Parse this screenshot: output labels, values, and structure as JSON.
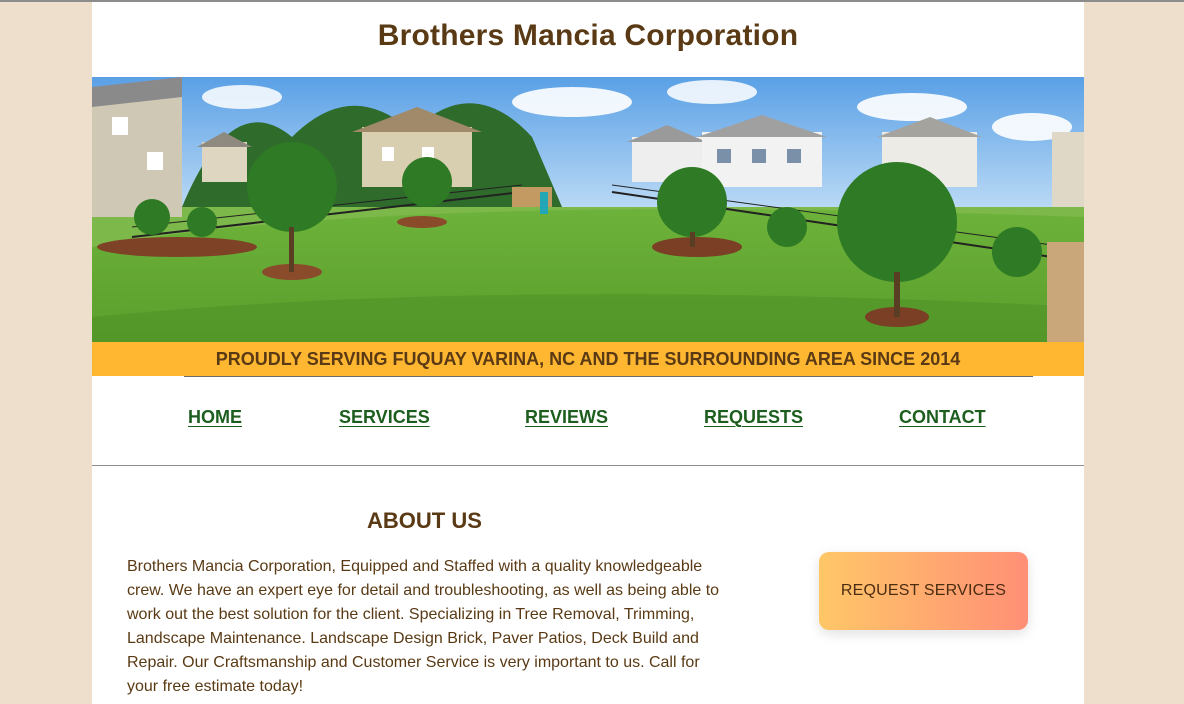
{
  "site": {
    "title": "Brothers Mancia Corporation",
    "banner": "PROUDLY SERVING FUQUAY VARINA, NC AND THE SURROUNDING AREA SINCE 2014"
  },
  "nav": {
    "home": "HOME",
    "services": "SERVICES",
    "reviews": "REVIEWS",
    "requests": "REQUESTS",
    "contact": "CONTACT"
  },
  "about": {
    "title": "ABOUT US",
    "text": "Brothers Mancia Corporation, Equipped and Staffed with a quality knowledgeable crew. We have an expert eye for detail and troubleshooting, as well as being able to work out the best solution for the client. Specializing in Tree Removal, Trimming, Landscape Maintenance. Landscape Design Brick, Paver Patios, Deck Build and Repair. Our Craftsmanship and Customer Service is very important to us. Call for your free estimate today!"
  },
  "cta": {
    "request_label": "REQUEST SERVICES"
  },
  "colors": {
    "page_background": "#eddfcb",
    "title_brown": "#5a3a14",
    "banner_yellow": "#ffb732",
    "nav_green": "#1d5e1f",
    "button_gradient_start": "#ffc768",
    "button_gradient_end": "#ff8f76"
  }
}
